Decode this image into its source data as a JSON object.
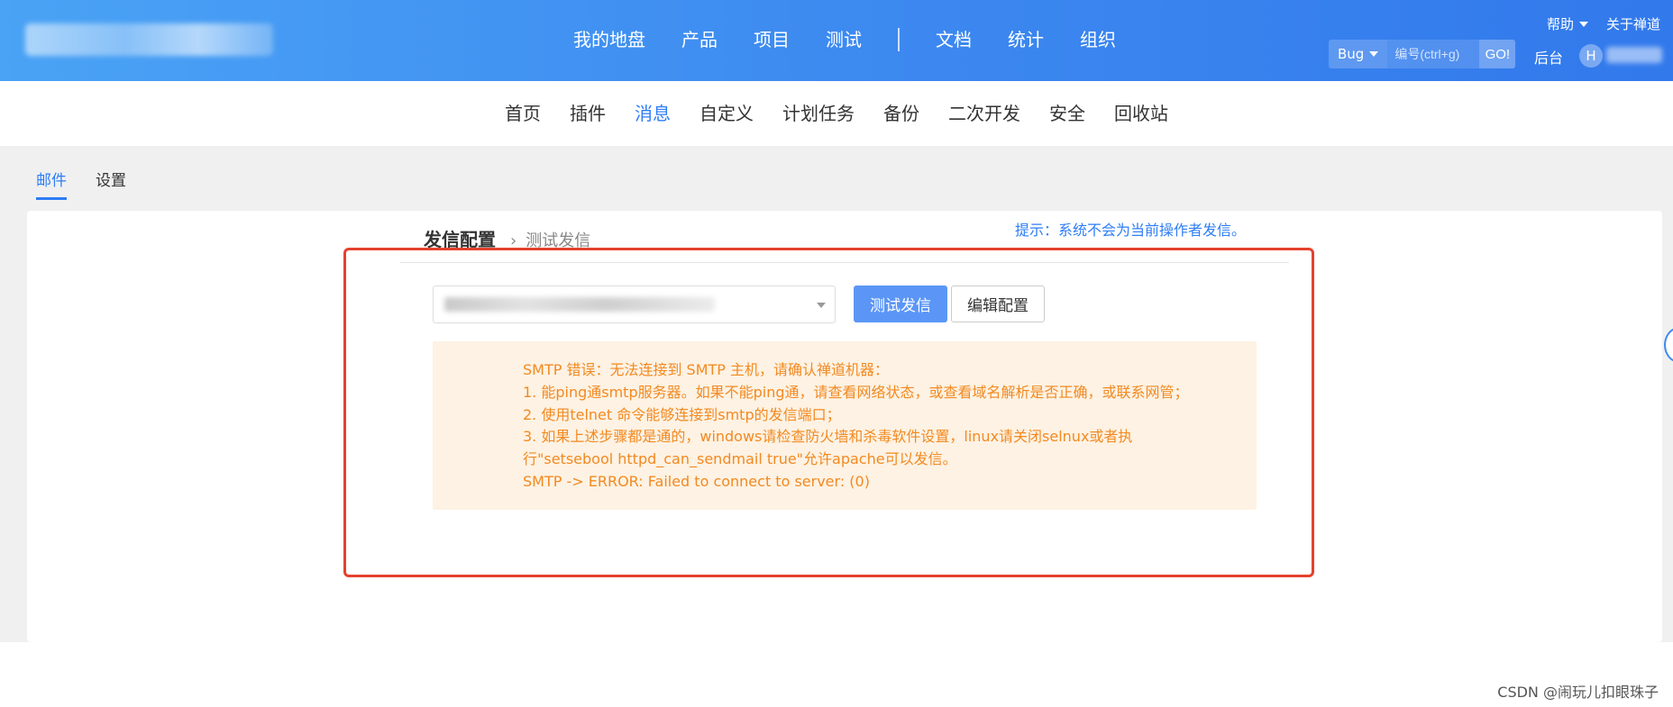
{
  "header": {
    "main_nav": [
      "我的地盘",
      "产品",
      "项目",
      "测试",
      "文档",
      "统计",
      "组织"
    ],
    "help_label": "帮助",
    "about_label": "关于禅道",
    "search": {
      "type_label": "Bug",
      "placeholder": "编号(ctrl+g)",
      "go_label": "GO!"
    },
    "admin_label": "后台",
    "avatar_initial": "H"
  },
  "subnav": {
    "items": [
      "首页",
      "插件",
      "消息",
      "自定义",
      "计划任务",
      "备份",
      "二次开发",
      "安全",
      "回收站"
    ],
    "active": "消息"
  },
  "tabs": {
    "items": [
      "邮件",
      "设置"
    ],
    "active": "邮件"
  },
  "breadcrumb": {
    "title": "发信配置",
    "arrow": "›",
    "current": "测试发信"
  },
  "tip": "提示：系统不会为当前操作者发信。",
  "buttons": {
    "test_send": "测试发信",
    "edit_config": "编辑配置"
  },
  "alert_lines": [
    "SMTP 错误：无法连接到 SMTP 主机，请确认禅道机器：",
    "1. 能ping通smtp服务器。如果不能ping通，请查看网络状态，或查看域名解析是否正确，或联系网管；",
    "2. 使用telnet 命令能够连接到smtp的发信端口；",
    "3. 如果上述步骤都是通的，windows请检查防火墙和杀毒软件设置，linux请关闭selnux或者执",
    "行\"setsebool httpd_can_sendmail true\"允许apache可以发信。",
    "SMTP -> ERROR: Failed to connect to server: (0)"
  ],
  "colors": {
    "header_gradient_start": "#4aa3f5",
    "header_gradient_end": "#3279ec",
    "accent": "#2e7df6",
    "alert_bg": "#fdf2e3",
    "alert_text": "#f28a22",
    "highlight_box": "#e5412d"
  },
  "watermark": "CSDN @闹玩儿扣眼珠子"
}
